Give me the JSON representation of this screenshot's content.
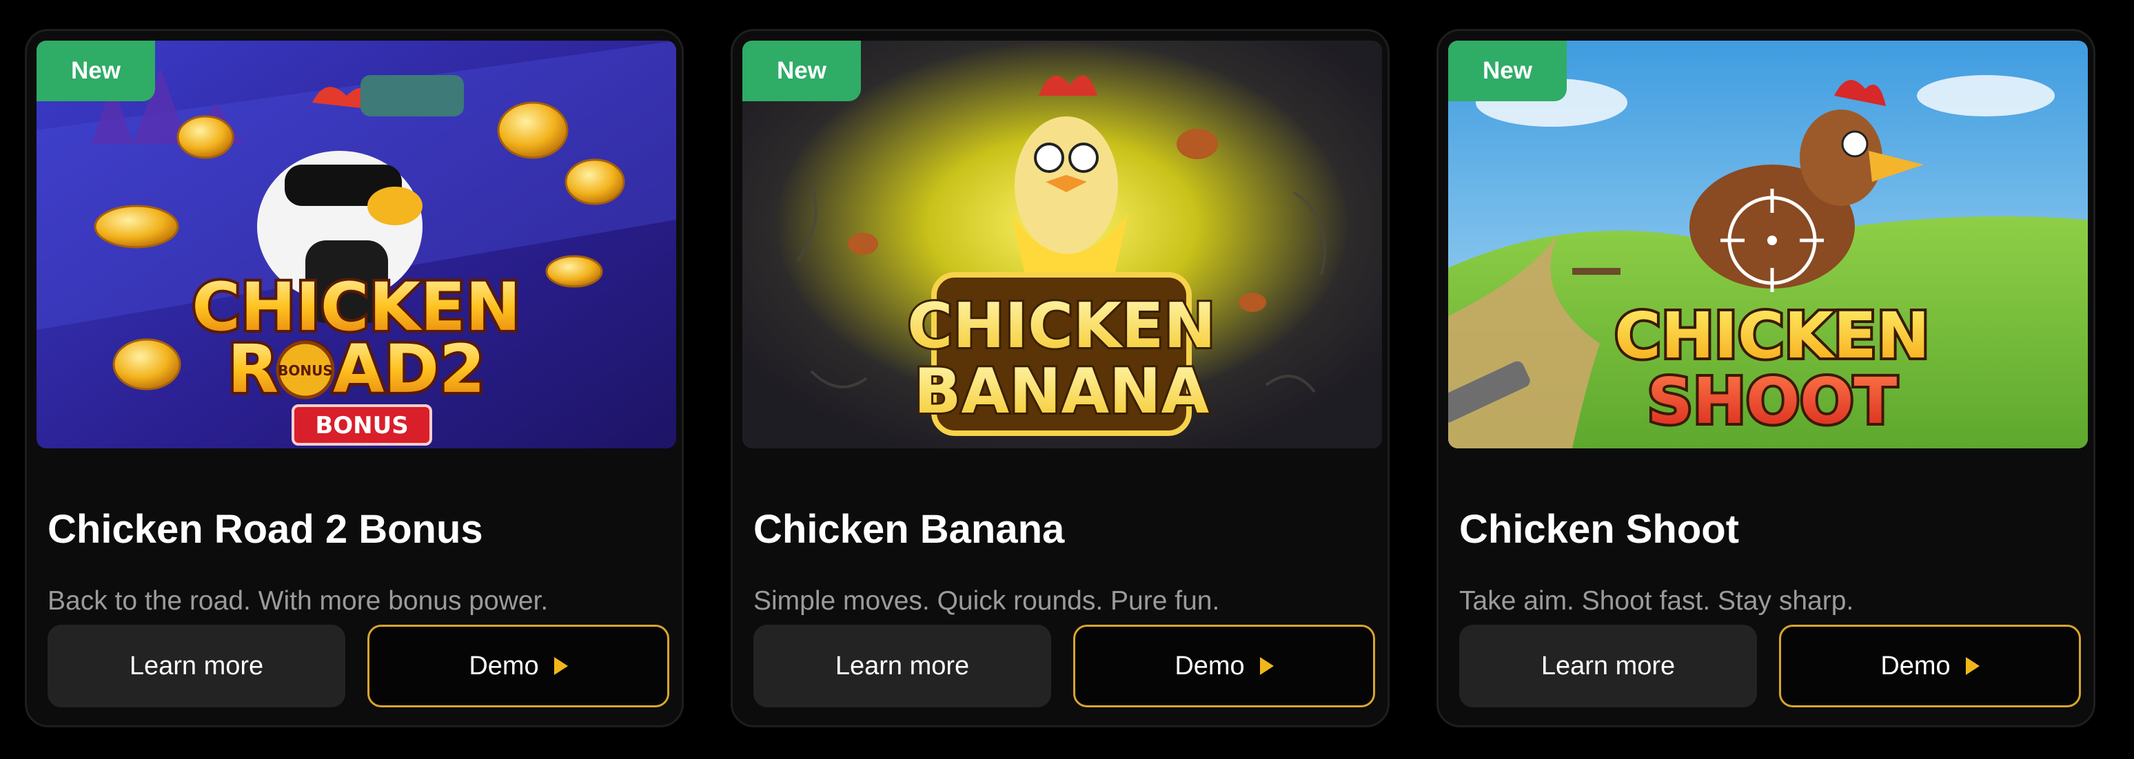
{
  "cards": [
    {
      "badge": "New",
      "title": "Chicken Road 2 Bonus",
      "description": "Back to the road. With more bonus power.",
      "learn_more": "Learn more",
      "demo": "Demo",
      "logo_lines": [
        "CHICKEN",
        "ROAD2"
      ],
      "logo_tag": "BONUS",
      "logo_coin": "BONUS"
    },
    {
      "badge": "New",
      "title": "Chicken Banana",
      "description": "Simple moves. Quick rounds. Pure fun.",
      "learn_more": "Learn more",
      "demo": "Demo",
      "logo_lines": [
        "CHICKEN",
        "BANANA"
      ]
    },
    {
      "badge": "New",
      "title": "Chicken Shoot",
      "description": "Take aim. Shoot fast. Stay sharp.",
      "learn_more": "Learn more",
      "demo": "Demo",
      "logo_lines": [
        "CHICKEN",
        "SHOOT"
      ]
    }
  ],
  "colors": {
    "badge": "#2fac66",
    "demo_border": "#d9a52c",
    "play_icon": "#f2b61b",
    "learn_more_bg": "#232323"
  },
  "icons": [
    "play-icon",
    "crosshair-icon"
  ]
}
